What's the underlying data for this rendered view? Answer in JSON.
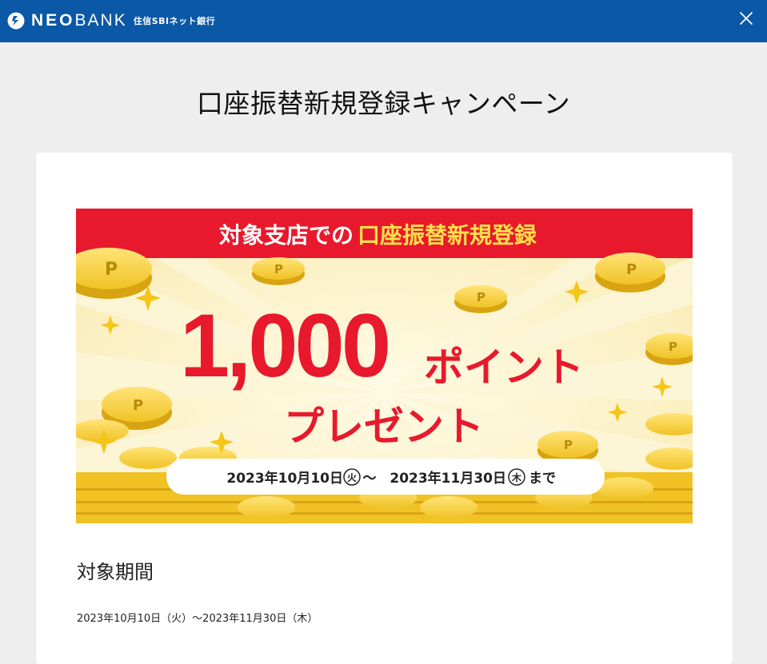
{
  "header": {
    "logo_neo": "NEO",
    "logo_bank": "BANK",
    "logo_sub": "住信SBIネット銀行",
    "bg_color": "#0a58a6"
  },
  "page": {
    "title": "口座振替新規登録キャンペーン"
  },
  "banner": {
    "headline_prefix": "対象支店での",
    "headline_highlight": "口座振替新規登録",
    "points": "1,000",
    "points_suffix": "ポイント",
    "present": "プレゼント",
    "period_start": "2023年10月10日",
    "period_start_day": "火",
    "period_tilde": "〜",
    "period_end": "2023年11月30日",
    "period_end_day": "木",
    "period_suffix": "まで",
    "colors": {
      "red": "#e8192c",
      "yellow_text": "#ffe14a",
      "gold": "#f2c230",
      "cream": "#fbf0c3"
    }
  },
  "details": {
    "section_title": "対象期間",
    "period_text": "2023年10月10日（火）〜2023年11月30日（木）"
  }
}
